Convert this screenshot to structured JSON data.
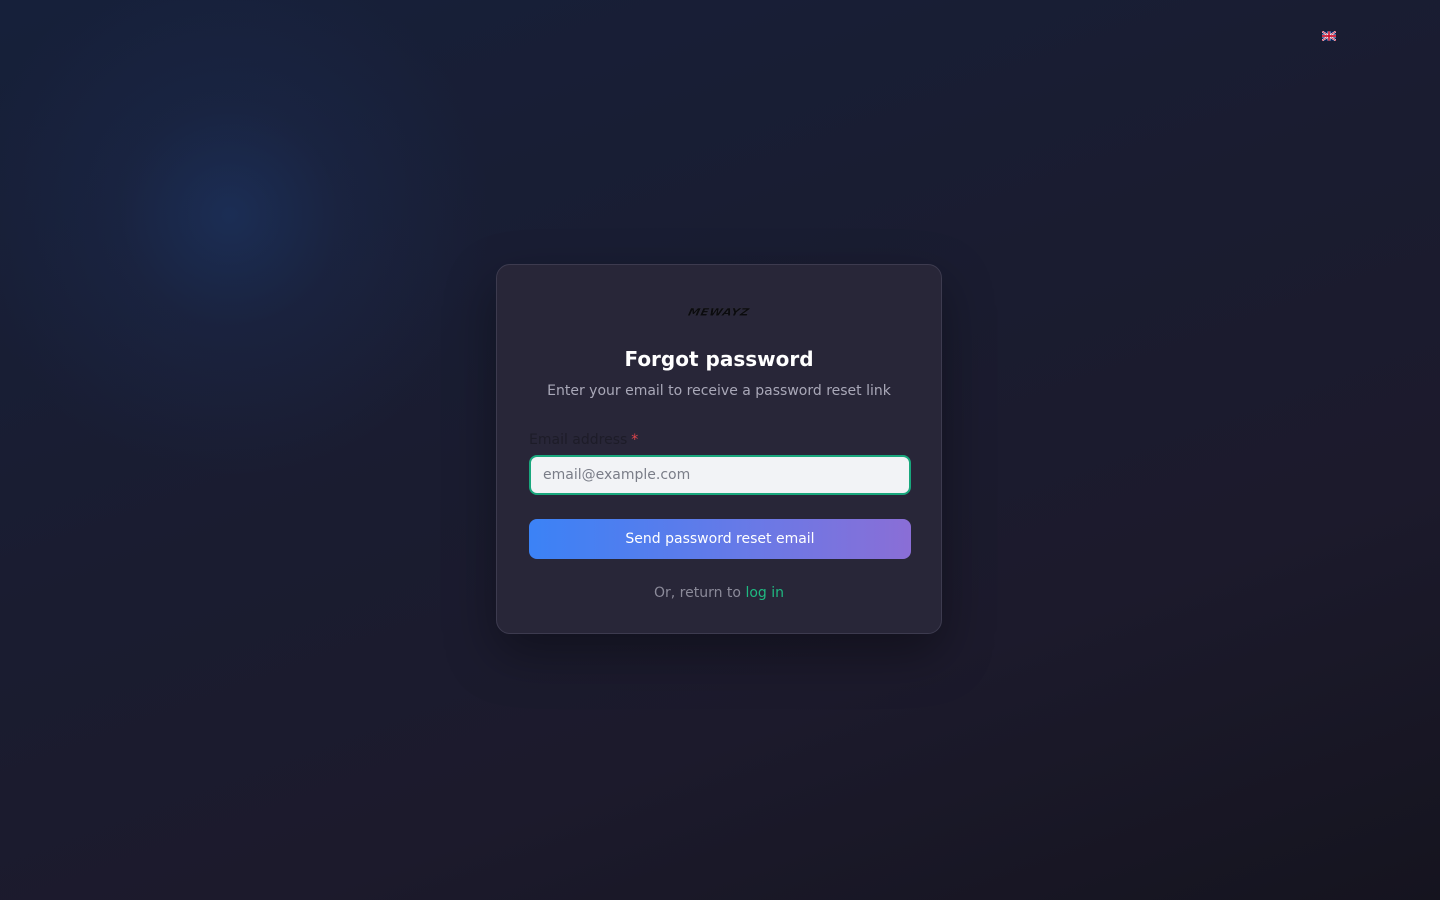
{
  "language": {
    "current_flag_icon": "uk-flag-icon"
  },
  "logo": {
    "text": "MEWAYZ"
  },
  "form": {
    "title": "Forgot password",
    "subtitle": "Enter your email to receive a password reset link",
    "email_label": "Email address",
    "required_marker": "*",
    "email_value": "",
    "email_placeholder": "email@example.com",
    "submit_label": "Send password reset email",
    "return_prefix": "Or, return to",
    "login_link": "log in"
  },
  "colors": {
    "accent_green": "#1fb981",
    "button_gradient_start": "#3b82f6",
    "button_gradient_end": "#8a6ed6",
    "required_red": "#e0464c"
  }
}
